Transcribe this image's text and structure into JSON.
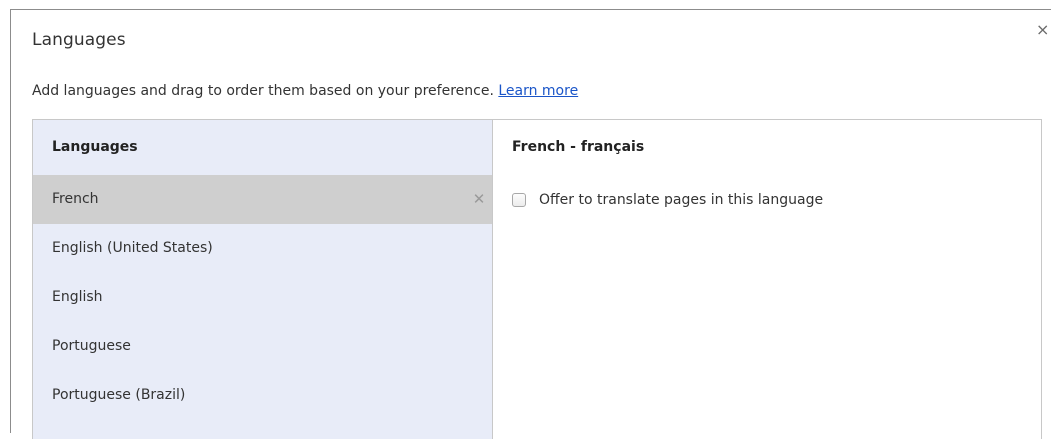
{
  "dialog": {
    "title": "Languages",
    "close_glyph": "×",
    "description": "Add languages and drag to order them based on your preference.",
    "learn_more": "Learn more"
  },
  "languages_list": {
    "header": "Languages",
    "items": [
      {
        "label": "French",
        "selected": true,
        "remove_glyph": "✕"
      },
      {
        "label": "English (United States)"
      },
      {
        "label": "English"
      },
      {
        "label": "Portuguese"
      },
      {
        "label": "Portuguese (Brazil)"
      }
    ]
  },
  "detail": {
    "title": "French - français",
    "translate_checkbox": {
      "label": "Offer to translate pages in this language",
      "checked": false
    }
  },
  "colors": {
    "list_background": "#e8ecf8",
    "selected_row": "#cfcfcf",
    "link": "#1a55c8"
  },
  "icons": [
    "close-icon",
    "remove-icon",
    "checkbox"
  ]
}
